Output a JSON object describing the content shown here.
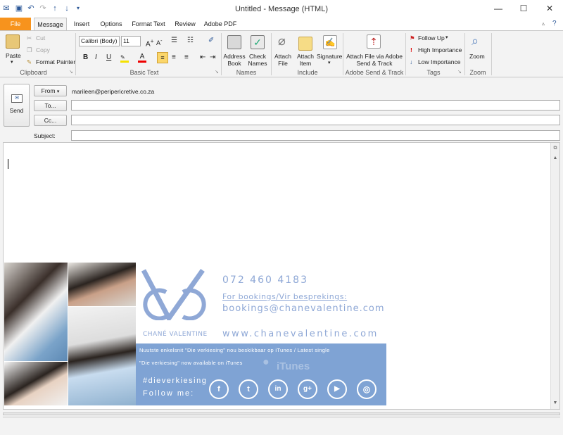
{
  "window": {
    "title": "Untitled - Message (HTML)"
  },
  "tabs": [
    "File",
    "Message",
    "Insert",
    "Options",
    "Format Text",
    "Review",
    "Adobe PDF"
  ],
  "ribbon": {
    "clipboard": {
      "paste": "Paste",
      "cut": "Cut",
      "copy": "Copy",
      "format_painter": "Format Painter",
      "label": "Clipboard"
    },
    "basic_text": {
      "font": "Calibri (Body)",
      "size": "11",
      "label": "Basic Text",
      "bold": "B",
      "italic": "I",
      "underline": "U"
    },
    "names": {
      "address_book": "Address Book",
      "check_names": "Check Names",
      "label": "Names"
    },
    "include": {
      "attach_file": "Attach File",
      "attach_item": "Attach Item",
      "signature": "Signature",
      "label": "Include"
    },
    "adobe": {
      "attach_via": "Attach File via Adobe Send & Track",
      "label": "Adobe Send & Track"
    },
    "tags": {
      "follow_up": "Follow Up",
      "high": "High Importance",
      "low": "Low Importance",
      "label": "Tags"
    },
    "zoom": {
      "zoom": "Zoom",
      "label": "Zoom"
    }
  },
  "compose": {
    "send": "Send",
    "from_btn": "From",
    "from_value": "marileen@peripericretive.co.za",
    "to_btn": "To...",
    "cc_btn": "Cc...",
    "subject_label": "Subject:"
  },
  "signature": {
    "brand": "CHANÉ VALENTINE",
    "phone": "072 460 4183",
    "bookings_label": "For bookings/Vir besprekings:",
    "email": "bookings@chanevalentine.com",
    "website": "www.chanevalentine.com",
    "banner_line1": "Nuutste enkelsnit \"Die verkiesing\" nou beskikbaar op iTunes / Latest single",
    "banner_line2": "\"Die verkiesing\" now available on iTunes",
    "itunes": "iTunes",
    "hashtag": "#dieverkiesing",
    "follow": "Follow me:",
    "social": [
      "f",
      "t",
      "in",
      "g+",
      "▶",
      "◎"
    ]
  }
}
